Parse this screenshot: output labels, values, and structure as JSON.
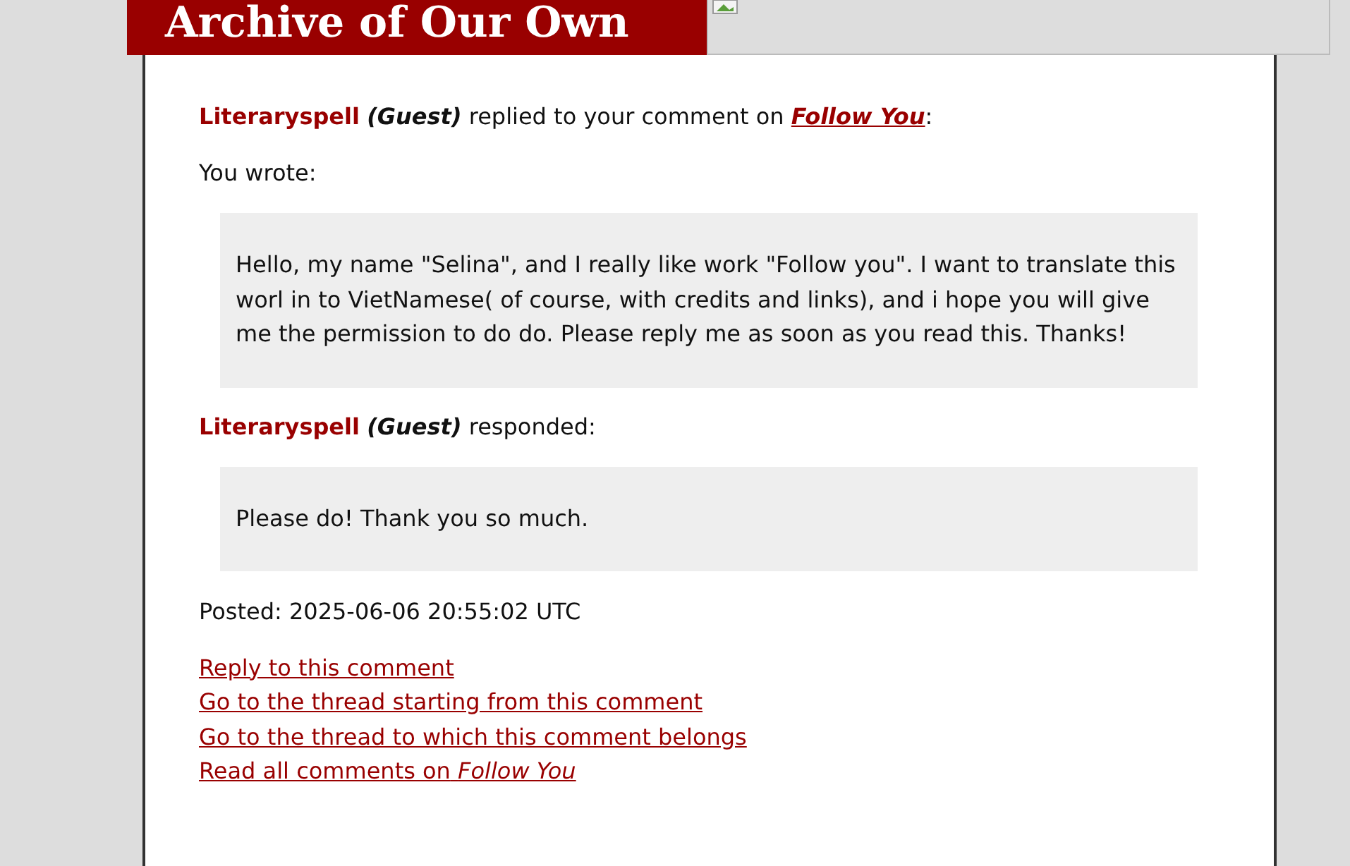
{
  "header": {
    "logo": "Archive of Our Own"
  },
  "notification": {
    "commenter": "Literaryspell",
    "guest_label": "(Guest)",
    "text": "replied to your comment on",
    "work": "Follow You",
    "end": ":"
  },
  "you_wrote": "You wrote:",
  "original_comment": "Hello, my name \"Selina\", and I really like work \"Follow you\". I want to translate this worl in to VietNamese( of course, with credits and links), and i hope you will give me the permission to do do. Please reply me as soon as you read this. Thanks!",
  "response": {
    "commenter": "Literaryspell",
    "guest_label": "(Guest)",
    "text": "responded:"
  },
  "reply_comment": "Please do! Thank you so much.",
  "posted": "Posted: 2025-06-06 20:55:02 UTC",
  "links": [
    {
      "text": "Reply to this comment"
    },
    {
      "text": "Go to the thread starting from this comment"
    },
    {
      "text": "Go to the thread to which this comment belongs"
    },
    {
      "text": "Read all comments on",
      "work": "Follow You"
    }
  ]
}
